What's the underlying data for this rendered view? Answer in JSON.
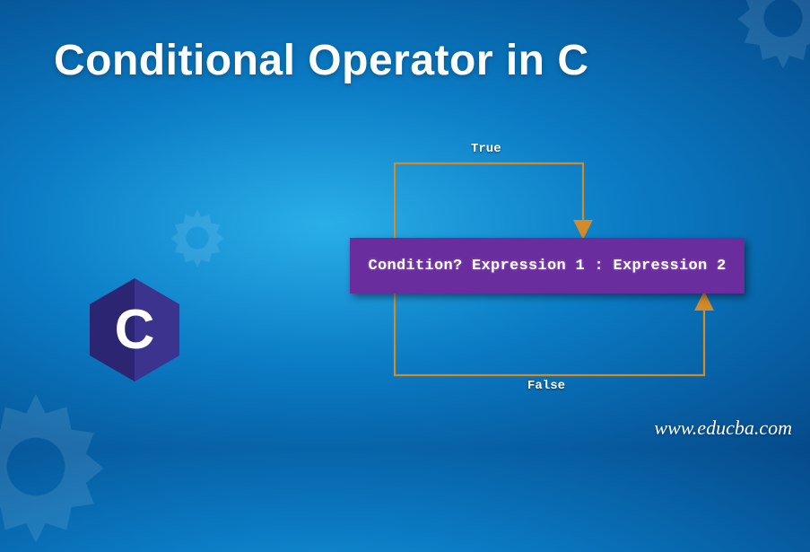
{
  "title": "Conditional Operator in C",
  "syntax": "Condition? Expression 1 : Expression 2",
  "labels": {
    "true": "True",
    "false": "False"
  },
  "watermark": "www.educba.com",
  "colors": {
    "box": "#6a2d9d",
    "arrow": "#d28a2a"
  }
}
